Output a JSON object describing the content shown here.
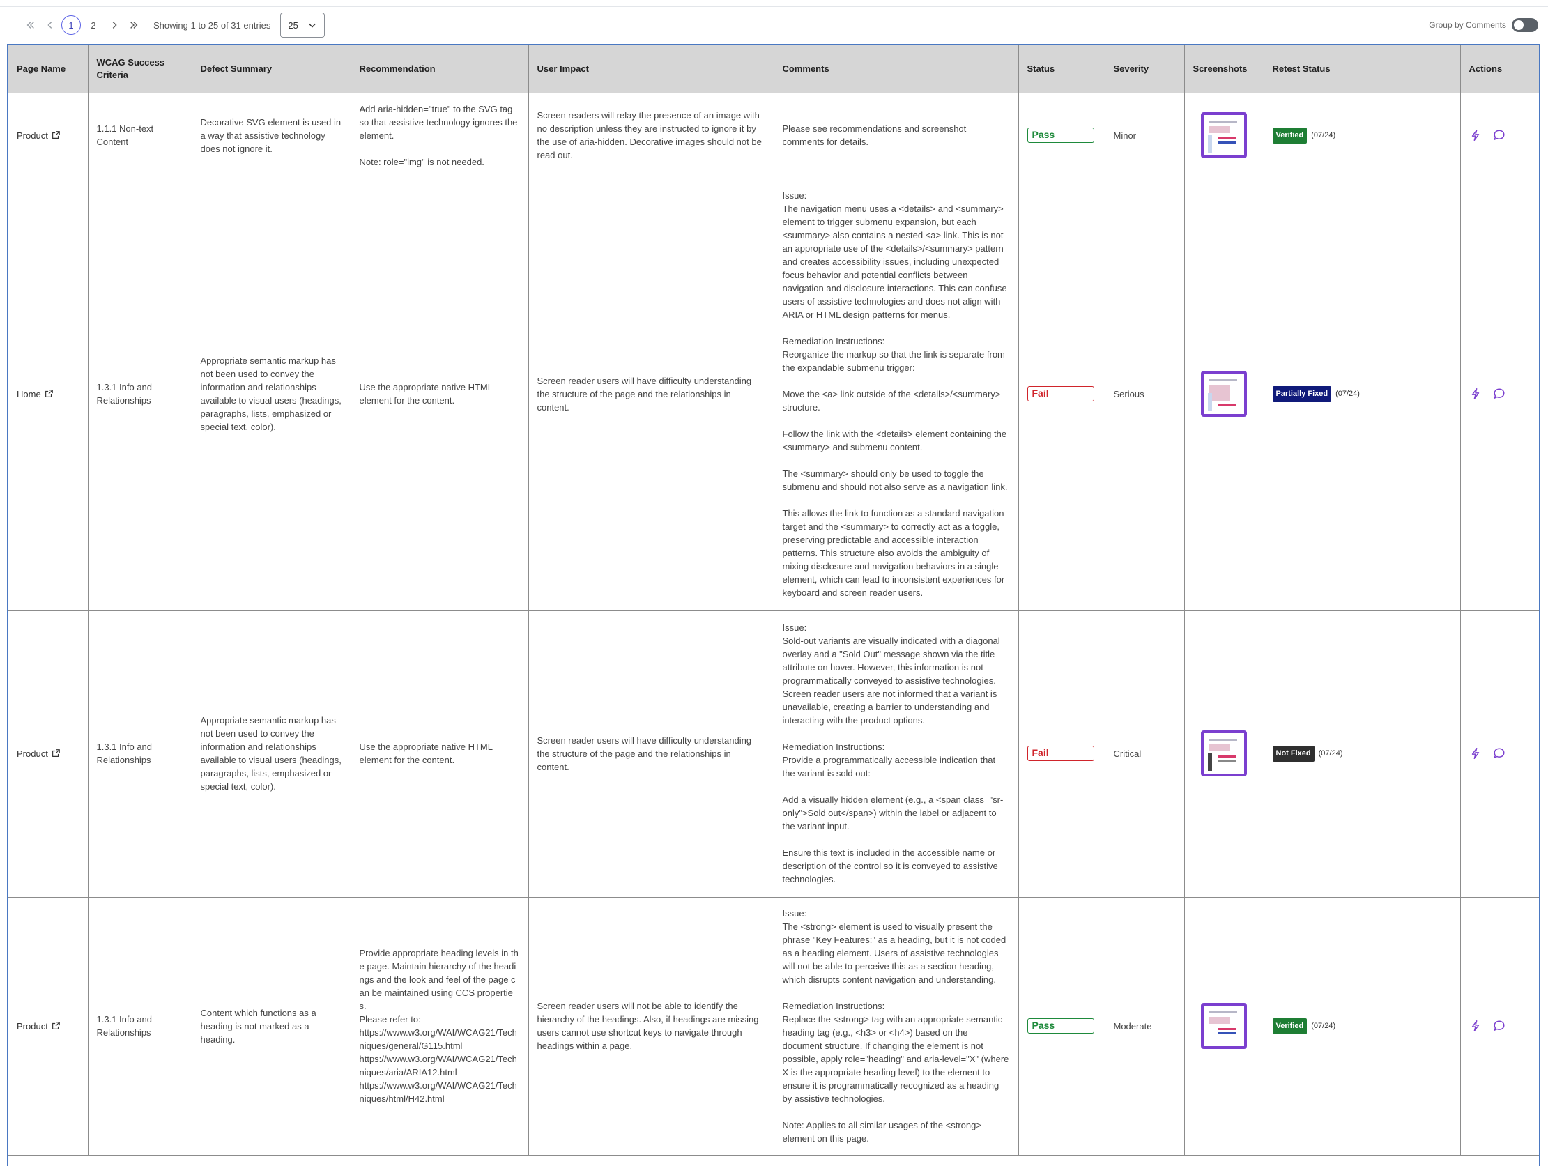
{
  "toolbar": {
    "pages": [
      "1",
      "2"
    ],
    "showing": "Showing 1 to 25 of 31 entries",
    "page_size": "25",
    "group_by_label": "Group by Comments"
  },
  "columns": [
    "Page Name",
    "WCAG Success Criteria",
    "Defect Summary",
    "Recommendation",
    "User Impact",
    "Comments",
    "Status",
    "Severity",
    "Screenshots",
    "Retest Status",
    "Actions"
  ],
  "rows": [
    {
      "page": "Product",
      "wcag": "1.1.1 Non-text Content",
      "defect": "Decorative SVG element is used in a way that assistive technology does not ignore it.",
      "recommendation": "Add aria-hidden=\"true\" to the SVG tag so that assistive technology ignores the element.\n\nNote: role=\"img\" is not needed.",
      "impact": "Screen readers will relay the presence of an image with no description unless they are instructed to ignore it by the use of aria-hidden. Decorative images should not be read out.",
      "comments": "Please see recommendations and screenshot comments for details.",
      "status": "Pass",
      "severity": "Minor",
      "retest": "Verified",
      "retest_date": "(07/24)"
    },
    {
      "page": "Home",
      "wcag": "1.3.1 Info and Relationships",
      "defect": "Appropriate semantic markup has not been used to convey the information and relationships available to visual users (headings, paragraphs, lists, emphasized or special text, color).",
      "recommendation": "Use the appropriate native HTML element for the content.",
      "impact": "Screen reader users will have difficulty understanding the structure of the page and the relationships in content.",
      "comments": "Issue:\nThe navigation menu uses a <details> and <summary> element to trigger submenu expansion, but each <summary> also contains a nested <a> link. This is not an appropriate use of the <details>/<summary> pattern and creates accessibility issues, including unexpected focus behavior and potential conflicts between navigation and disclosure interactions. This can confuse users of assistive technologies and does not align with ARIA or HTML design patterns for menus.\n\nRemediation Instructions:\nReorganize the markup so that the link is separate from the expandable submenu trigger:\n\nMove the <a> link outside of the <details>/<summary> structure.\n\nFollow the link with the <details> element containing the <summary> and submenu content.\n\nThe <summary> should only be used to toggle the submenu and should not also serve as a navigation link.\n\nThis allows the link to function as a standard navigation target and the <summary> to correctly act as a toggle, preserving predictable and accessible interaction patterns. This structure also avoids the ambiguity of mixing disclosure and navigation behaviors in a single element, which can lead to inconsistent experiences for keyboard and screen reader users.",
      "status": "Fail",
      "severity": "Serious",
      "retest": "Partially Fixed",
      "retest_date": "(07/24)"
    },
    {
      "page": "Product",
      "wcag": "1.3.1 Info and Relationships",
      "defect": "Appropriate semantic markup has not been used to convey the information and relationships available to visual users (headings, paragraphs, lists, emphasized or special text, color).",
      "recommendation": "Use the appropriate native HTML element for the content.",
      "impact": "Screen reader users will have difficulty understanding the structure of the page and the relationships in content.",
      "comments": "Issue:\nSold-out variants are visually indicated with a diagonal overlay and a \"Sold Out\" message shown via the title attribute on hover. However, this information is not programmatically conveyed to assistive technologies. Screen reader users are not informed that a variant is unavailable, creating a barrier to understanding and interacting with the product options.\n\nRemediation Instructions:\nProvide a programmatically accessible indication that the variant is sold out:\n\nAdd a visually hidden element (e.g., a <span class=\"sr-only\">Sold out</span>) within the label or adjacent to the variant input.\n\nEnsure this text is included in the accessible name or description of the control so it is conveyed to assistive technologies.",
      "status": "Fail",
      "severity": "Critical",
      "retest": "Not Fixed",
      "retest_date": "(07/24)"
    },
    {
      "page": "Product",
      "wcag": "1.3.1 Info and Relationships",
      "defect": "Content which functions as a heading is not marked as a heading.",
      "recommendation": "Provide appropriate heading levels in the page. Maintain hierarchy of the headings and the look and feel of the page can be maintained using CCS properties.\nPlease refer to:\nhttps://www.w3.org/WAI/WCAG21/Techniques/general/G115.html\nhttps://www.w3.org/WAI/WCAG21/Techniques/aria/ARIA12.html\nhttps://www.w3.org/WAI/WCAG21/Techniques/html/H42.html",
      "impact": "Screen reader users will not be able to identify the hierarchy of the headings. Also, if headings are missing users cannot use shortcut keys to navigate through headings within a page.",
      "comments": "Issue:\nThe <strong> element is used to visually present the phrase \"Key Features:\" as a heading, but it is not coded as a heading element. Users of assistive technologies will not be able to perceive this as a section heading, which disrupts content navigation and understanding.\n\nRemediation Instructions:\nReplace the <strong> tag with an appropriate semantic heading tag (e.g., <h3> or <h4>) based on the document structure. If changing the element is not possible, apply role=\"heading\" and aria-level=\"X\" (where X is the appropriate heading level) to the element to ensure it is programmatically recognized as a heading by assistive technologies.\n\nNote: Applies to all similar usages of the <strong> element on this page.",
      "status": "Pass",
      "severity": "Moderate",
      "retest": "Verified",
      "retest_date": "(07/24)"
    }
  ]
}
